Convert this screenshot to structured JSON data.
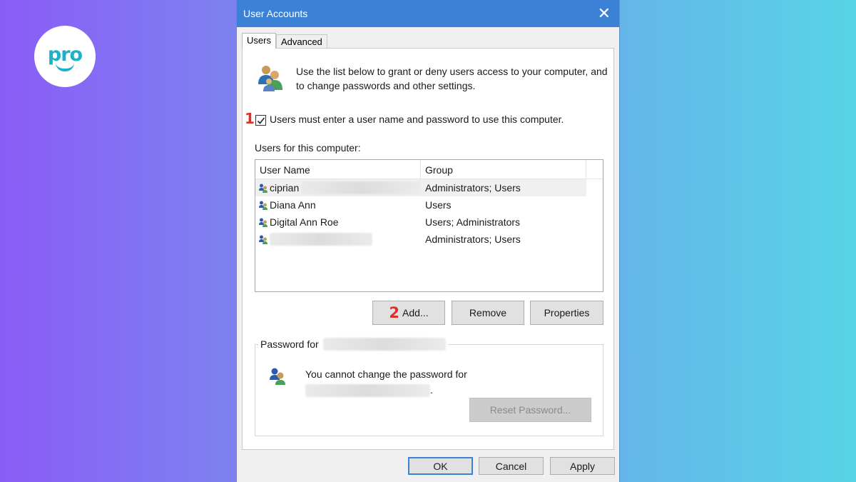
{
  "brand": {
    "logo_text": "pro"
  },
  "window": {
    "title": "User Accounts",
    "close_glyph": "✕"
  },
  "tabs": [
    {
      "label": "Users",
      "active": true
    },
    {
      "label": "Advanced",
      "active": false
    }
  ],
  "intro": {
    "text": "Use the list below to grant or deny users access to your computer, and to change passwords and other settings."
  },
  "annotations": {
    "step1": "1",
    "step2": "2"
  },
  "checkbox": {
    "label": "Users must enter a user name and password to use this computer.",
    "checked": true
  },
  "users": {
    "section_label": "Users for this computer:",
    "columns": [
      "User Name",
      "Group"
    ],
    "rows": [
      {
        "name": "ciprian",
        "group": "Administrators; Users",
        "selected": true
      },
      {
        "name": "Diana Ann",
        "group": "Users",
        "selected": false
      },
      {
        "name": "Digital Ann Roe",
        "group": "Users; Administrators",
        "selected": false
      },
      {
        "name": "",
        "group": "Administrators; Users",
        "selected": false
      }
    ]
  },
  "buttons": {
    "add": "Add...",
    "remove": "Remove",
    "properties": "Properties"
  },
  "password_group": {
    "legend": "Password for",
    "message": "You cannot change the password for",
    "message_end": ".",
    "reset_button": "Reset Password..."
  },
  "footer": {
    "ok": "OK",
    "cancel": "Cancel",
    "apply": "Apply"
  },
  "colors": {
    "titlebar": "#3b82d6",
    "annotation": "#e0302a",
    "logo": "#1ab3c9"
  }
}
